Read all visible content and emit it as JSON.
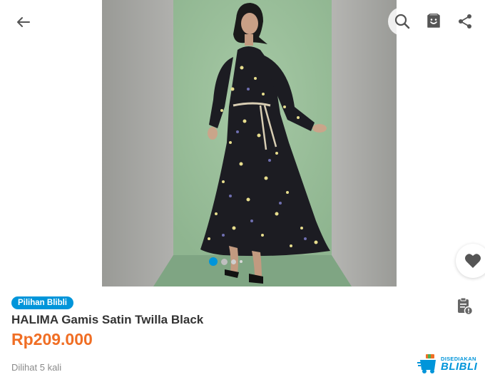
{
  "topbar": {
    "back_icon": "arrow-left-icon",
    "actions": [
      {
        "name": "search",
        "icon": "search-icon"
      },
      {
        "name": "cart",
        "icon": "shopping-bag-icon"
      },
      {
        "name": "share",
        "icon": "share-icon"
      }
    ]
  },
  "gallery": {
    "image_count": 4,
    "active_index": 0
  },
  "product": {
    "badge": "Pilihan Blibli",
    "title": "HALIMA Gamis Satin Twilla Black",
    "price": "Rp209.000",
    "views": "Dilihat 5 kali"
  },
  "fulfilled_by": {
    "small": "DISEDIAKAN",
    "big": "BLIBLI"
  },
  "colors": {
    "accent": "#0095da",
    "price": "#f06e24",
    "backdrop_green": "#9bbf9b",
    "backdrop_grey": "#a3a39f",
    "floor": "#7fa583",
    "dress": "#1c1c22"
  }
}
